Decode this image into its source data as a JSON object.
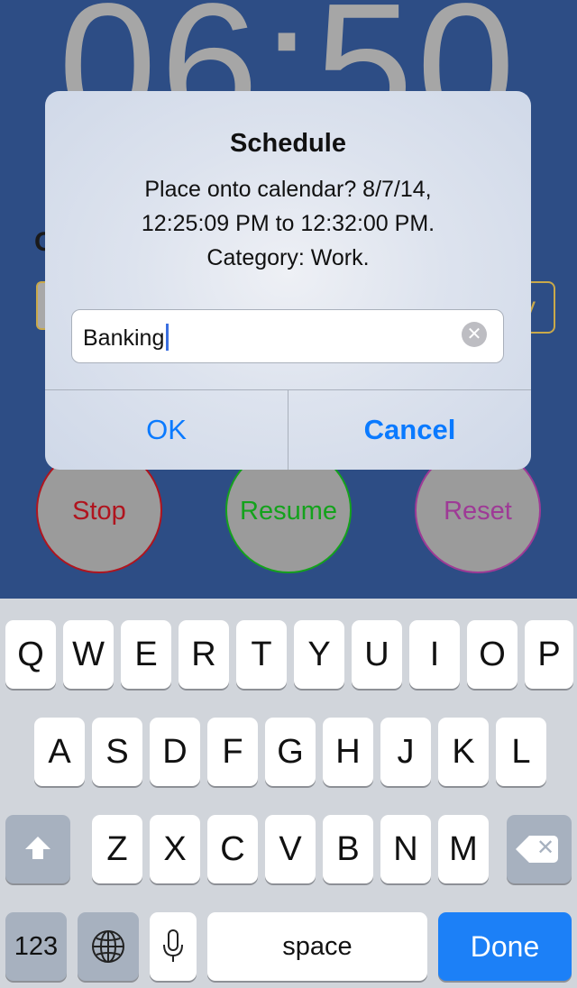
{
  "background": {
    "clock_time": "06:50",
    "partial_label": "C",
    "partial_field_right": "y",
    "buttons": {
      "stop": "Stop",
      "resume": "Resume",
      "reset": "Reset"
    },
    "colors": {
      "background": "#2d4d85",
      "stop": "#b0141e",
      "resume": "#14a21c",
      "reset": "#9e3a96",
      "field_border": "#c9a94a"
    }
  },
  "alert": {
    "title": "Schedule",
    "message_line1": "Place onto calendar? 8/7/14,",
    "message_line2": "12:25:09 PM to 12:32:00 PM.",
    "message_line3": "Category: Work.",
    "input_value": "Banking",
    "ok_label": "OK",
    "cancel_label": "Cancel",
    "accent_color": "#0a7aff"
  },
  "keyboard": {
    "row1": [
      "Q",
      "W",
      "E",
      "R",
      "T",
      "Y",
      "U",
      "I",
      "O",
      "P"
    ],
    "row2": [
      "A",
      "S",
      "D",
      "F",
      "G",
      "H",
      "J",
      "K",
      "L"
    ],
    "row3": [
      "Z",
      "X",
      "C",
      "V",
      "B",
      "N",
      "M"
    ],
    "numbers_label": "123",
    "space_label": "space",
    "done_label": "Done",
    "icons": {
      "shift": "shift-icon",
      "backspace": "backspace-icon",
      "globe": "globe-icon",
      "microphone": "microphone-icon"
    },
    "done_color": "#1c80f7"
  }
}
